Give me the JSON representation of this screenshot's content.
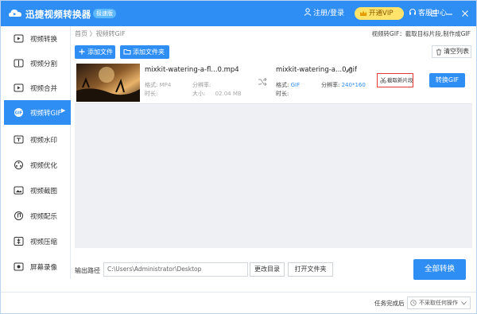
{
  "titlebar": {
    "app_title": "迅捷视频转换器",
    "badge": "极速版",
    "login": "注册/登录",
    "vip": "开通VIP",
    "help": "客服中心"
  },
  "sidebar": {
    "items": [
      {
        "label": "视频转换",
        "icon": "video-convert-icon"
      },
      {
        "label": "视频分割",
        "icon": "split-icon"
      },
      {
        "label": "视频合并",
        "icon": "merge-icon"
      },
      {
        "label": "视频转GIF",
        "icon": "gif-icon",
        "active": true
      },
      {
        "label": "视频水印",
        "icon": "watermark-icon"
      },
      {
        "label": "视频优化",
        "icon": "optimize-icon"
      },
      {
        "label": "视频截图",
        "icon": "screenshot-icon"
      },
      {
        "label": "视频配乐",
        "icon": "music-icon"
      },
      {
        "label": "视频压缩",
        "icon": "compress-icon"
      },
      {
        "label": "屏幕录像",
        "icon": "record-icon"
      }
    ],
    "active_arrow": "▶"
  },
  "main": {
    "breadcrumb": "首页 〉视频转GIF",
    "hint": "视频转GIF：截取目标片段,制作成GIF",
    "add_file": "添加文件",
    "add_folder": "添加文件夹",
    "clear_list": "清空列表"
  },
  "task": {
    "source_name": "mixkit-watering-a-fl...0.mp4",
    "source_format_label": "格式:",
    "source_format": "MP4",
    "source_resolution_label": "分辨率:",
    "source_resolution": "",
    "source_duration_label": "时长:",
    "source_duration": "",
    "source_size_label": "大小:",
    "source_size": "02.04 MB",
    "target_name": "mixkit-watering-a...0.gif",
    "target_format_label": "格式:",
    "target_format": "GIF",
    "target_resolution_label": "分辨率:",
    "target_resolution": "240*160",
    "target_duration_label": "时长:",
    "trim_label": "截取新片段",
    "convert_gif_label": "转换GIF"
  },
  "bottom": {
    "output_label": "输出路径",
    "output_path": "C:\\Users\\Administrator\\Desktop",
    "change_dir": "更改目录",
    "open_folder": "打开文件夹",
    "convert_all": "全部转换"
  },
  "status": {
    "after_task_label": "任务完成后",
    "after_task_value": "不采取任何操作"
  },
  "colors": {
    "accent": "#2f8ef4",
    "vip": "#ffe36b",
    "trim_border": "#e53935"
  }
}
